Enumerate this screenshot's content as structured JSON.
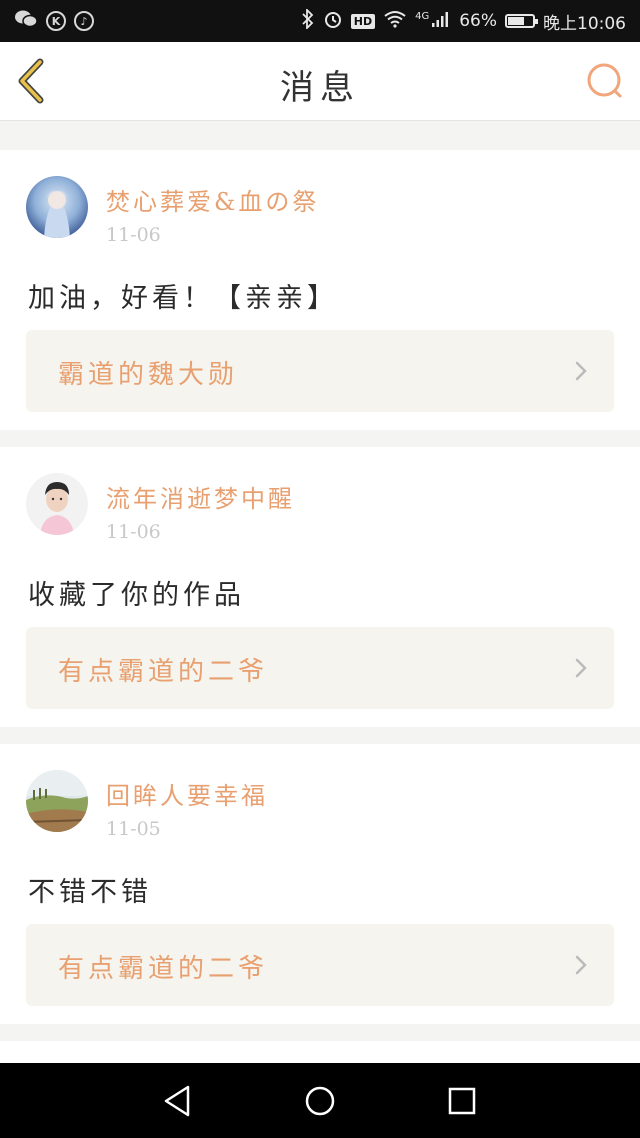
{
  "status_bar": {
    "network": "4G",
    "hd": "HD",
    "battery": "66%",
    "battery_level": 0.66,
    "time": "晚上10:06"
  },
  "header": {
    "title": "消息"
  },
  "colors": {
    "accent": "#e8a070",
    "back_icon": "#d4a02a"
  },
  "messages": [
    {
      "username": "焚心葬爱&血の祭",
      "date": "11-06",
      "content": "加油，好看！【亲亲】",
      "work_title": "霸道的魏大勋"
    },
    {
      "username": "流年消逝梦中醒",
      "date": "11-06",
      "content": "收藏了你的作品",
      "work_title": "有点霸道的二爷"
    },
    {
      "username": "回眸人要幸福",
      "date": "11-05",
      "content": "不错不错",
      "work_title": "有点霸道的二爷"
    }
  ]
}
